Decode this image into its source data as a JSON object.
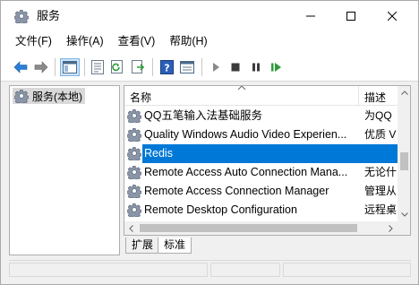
{
  "window": {
    "title": "服务",
    "app_icon": "services-gear-icon"
  },
  "window_controls": {
    "minimize": "minimize-icon",
    "maximize": "maximize-icon",
    "close": "close-icon"
  },
  "menu": [
    {
      "label": "文件(F)"
    },
    {
      "label": "操作(A)"
    },
    {
      "label": "查看(V)"
    },
    {
      "label": "帮助(H)"
    }
  ],
  "toolbar": {
    "buttons": [
      "back-icon",
      "forward-icon",
      "show-hide-tree-icon",
      "properties-icon",
      "refresh-icon",
      "export-list-icon",
      "help-icon",
      "view-icon",
      "start-service-icon",
      "stop-service-icon",
      "pause-service-icon",
      "restart-service-icon"
    ]
  },
  "tree": {
    "items": [
      {
        "label": "服务(本地)",
        "icon": "services-gear-icon",
        "selected": true
      }
    ]
  },
  "list": {
    "columns": {
      "name": "名称",
      "description": "描述"
    },
    "rows": [
      {
        "name": "QQ五笔输入法基础服务",
        "description": "为QQ",
        "icon": "service-gear-icon",
        "selected": false
      },
      {
        "name": "Quality Windows Audio Video Experien...",
        "description": "优质 V",
        "icon": "service-gear-icon",
        "selected": false
      },
      {
        "name": "Redis",
        "description": "",
        "icon": "service-gear-icon",
        "selected": true
      },
      {
        "name": "Remote Access Auto Connection Mana...",
        "description": "无论什",
        "icon": "service-gear-icon",
        "selected": false
      },
      {
        "name": "Remote Access Connection Manager",
        "description": "管理从",
        "icon": "service-gear-icon",
        "selected": false
      },
      {
        "name": "Remote Desktop Configuration",
        "description": "远程桌",
        "icon": "service-gear-icon",
        "selected": false
      }
    ]
  },
  "tabs": [
    {
      "label": "扩展",
      "active": false
    },
    {
      "label": "标准",
      "active": true
    }
  ],
  "colors": {
    "selection": "#0078d7",
    "tree_selection": "#d9d9d9",
    "window_bg": "#f0f0f0"
  }
}
